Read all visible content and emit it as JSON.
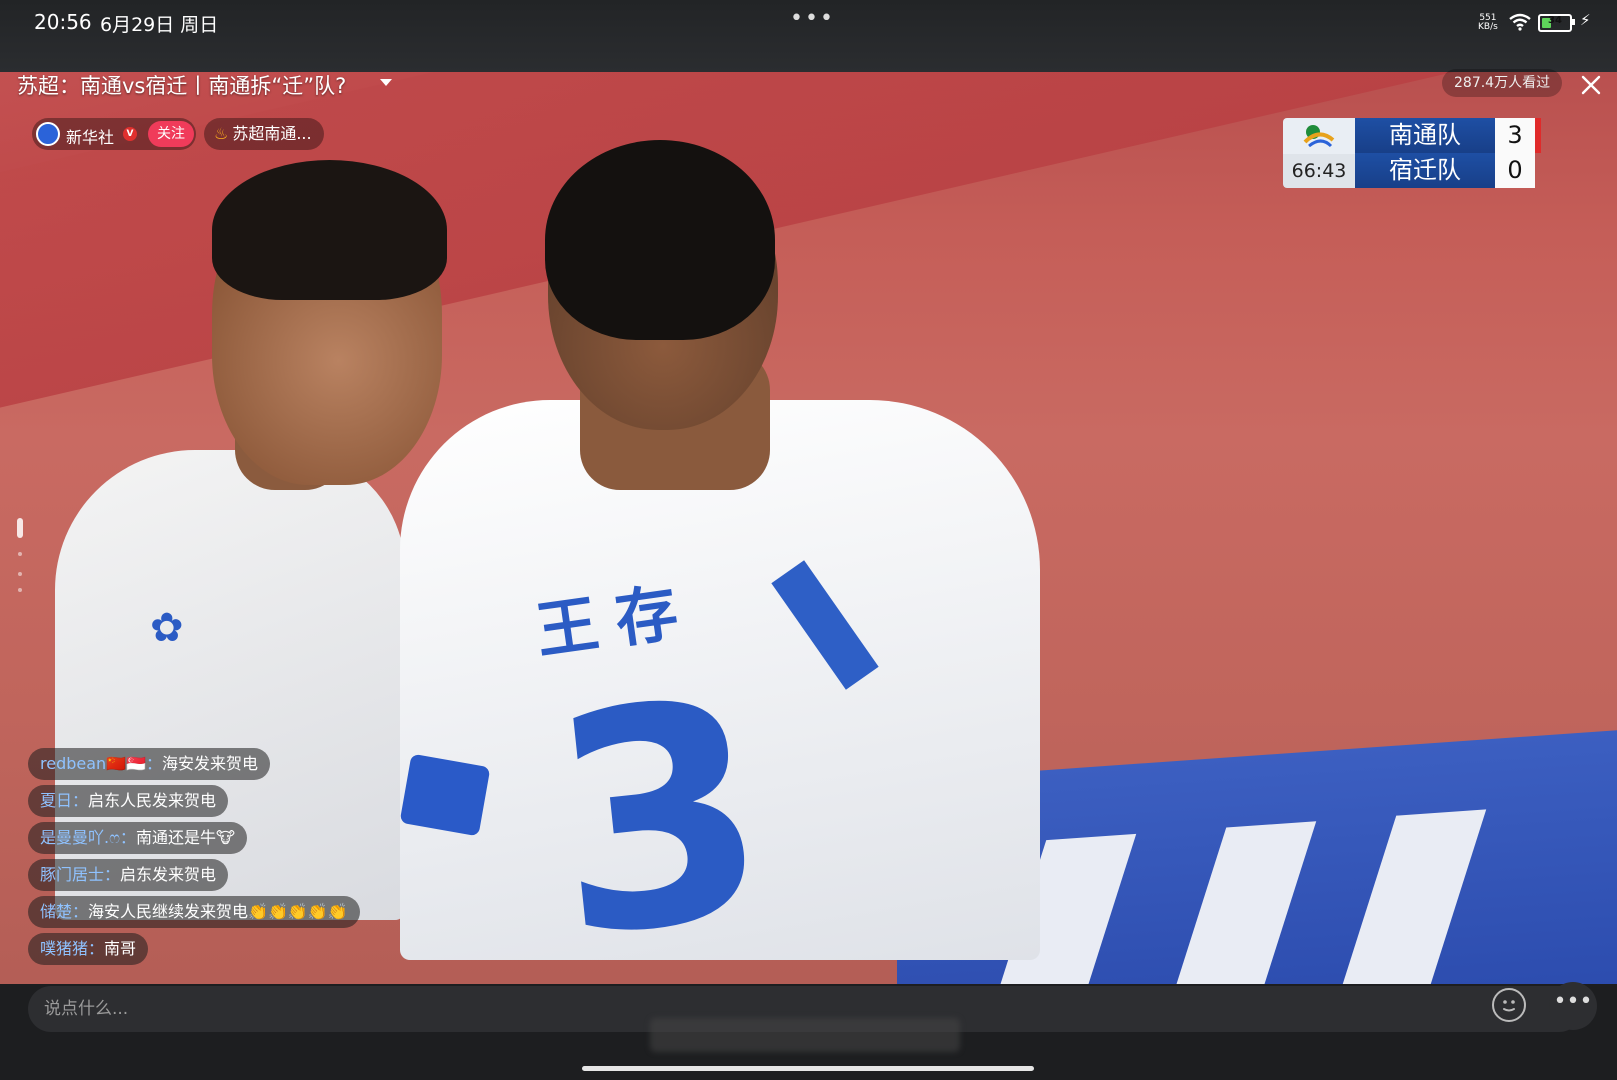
{
  "status_bar": {
    "time": "20:56",
    "date": "6月29日 周日",
    "net_speed_value": "551",
    "net_speed_unit": "KB/s",
    "battery": "34",
    "battery_level_percent": 34
  },
  "stream": {
    "title": "苏超：南通vs宿迁丨南通拆“迁”队?",
    "viewers": "287.4万人看过",
    "host_name": "新华社",
    "verified_mark": "V",
    "follow_label": "关注",
    "topic": "苏超南通..."
  },
  "scoreboard": {
    "clock": "66:43",
    "home_team": "南通队",
    "home_score": "3",
    "away_team": "宿迁队",
    "away_score": "0"
  },
  "video_overlay": {
    "jersey_name": "王存",
    "jersey_number": "3"
  },
  "chat": [
    {
      "user": "redbean🇨🇳🇸🇬",
      "text": "海安发来贺电"
    },
    {
      "user": "夏日",
      "text": "启东人民发来贺电"
    },
    {
      "user": "是曼曼吖.ෆ",
      "text": "南通还是牛🐮"
    },
    {
      "user": "豚门居士",
      "text": "启东发来贺电"
    },
    {
      "user": "储楚",
      "text": "海安人民继续发来贺电👏👏👏👏👏"
    },
    {
      "user": "噗猪猪",
      "text": "南哥"
    }
  ],
  "input": {
    "placeholder": "说点什么..."
  },
  "colors": {
    "follow": "#f03b5a",
    "chat_username": "#8fc2ff",
    "scoreboard_team_bg": "#1e4fa4",
    "jersey_blue": "#2b5bc4"
  },
  "icons": {
    "close": "close-icon",
    "emoji": "emoji-icon",
    "more": "more-icon",
    "wifi": "wifi-icon",
    "charging": "charging-icon",
    "fire": "fire-icon"
  }
}
